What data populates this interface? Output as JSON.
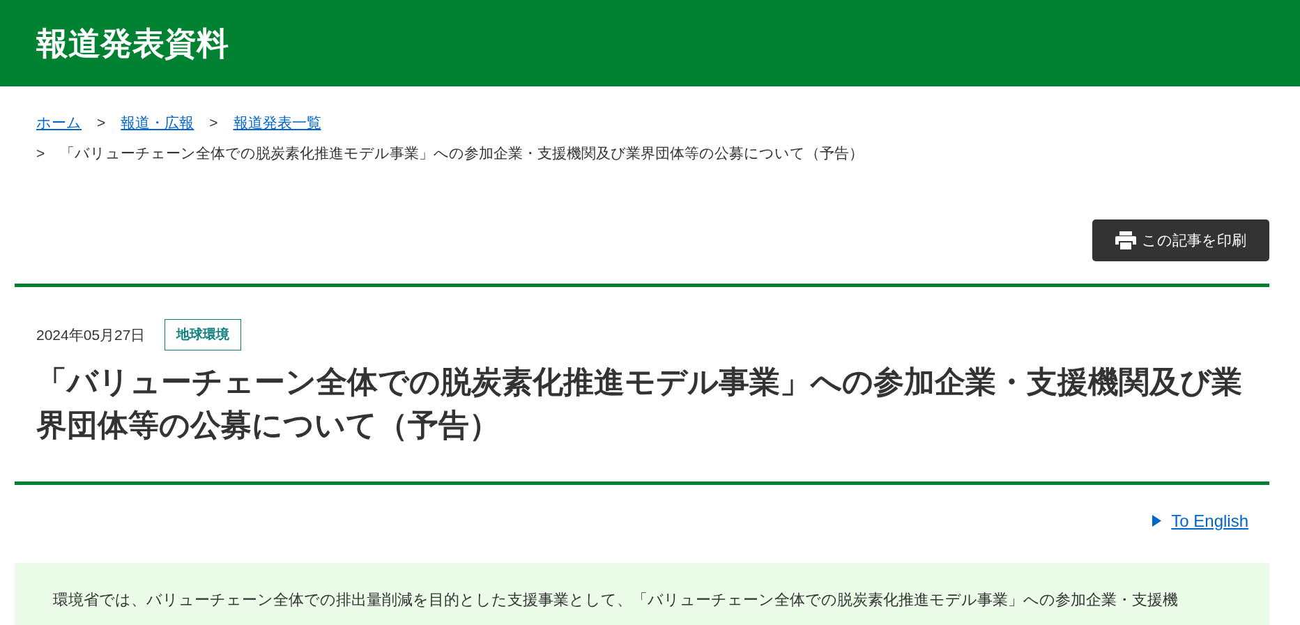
{
  "header": {
    "title": "報道発表資料"
  },
  "breadcrumb": {
    "links": [
      {
        "label": "ホーム"
      },
      {
        "label": "報道・広報"
      },
      {
        "label": "報道発表一覧"
      }
    ],
    "separator": ">",
    "current": "「バリューチェーン全体での脱炭素化推進モデル事業」への参加企業・支援機関及び業界団体等の公募について（予告）"
  },
  "print_button": {
    "label": "この記事を印刷"
  },
  "article": {
    "date": "2024年05月27日",
    "tag": "地球環境",
    "title": "「バリューチェーン全体での脱炭素化推進モデル事業」への参加企業・支援機関及び業界団体等の公募について（予告）"
  },
  "language_link": {
    "label": "To English"
  },
  "summary": {
    "text": "環境省では、バリューチェーン全体での排出量削減を目的とした支援事業として、「バリューチェーン全体での脱炭素化推進モデル事業」への参加企業・支援機"
  }
}
